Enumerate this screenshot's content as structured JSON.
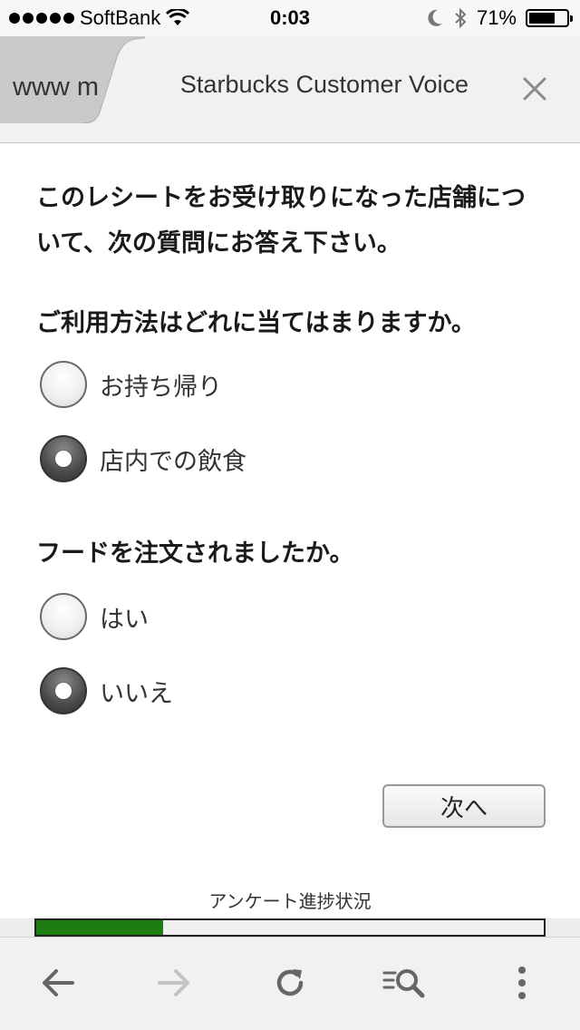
{
  "status_bar": {
    "carrier": "SoftBank",
    "time": "0:03",
    "battery": "71%",
    "battery_level": 0.71,
    "icons": [
      "signal-icon",
      "wifi-icon",
      "moon-icon",
      "bluetooth-icon",
      "battery-icon"
    ]
  },
  "tabs": {
    "inactive_label": "www m",
    "active_title": "Starbucks Customer Voice",
    "close_icon": "close-icon"
  },
  "survey": {
    "intro": "このレシートをお受け取りになった店舗について、次の質問にお答え下さい。",
    "question1": "ご利用方法はどれに当てはまりますか。",
    "q1_options": [
      {
        "label": "お持ち帰り",
        "checked": false
      },
      {
        "label": "店内での飲食",
        "checked": true
      }
    ],
    "question2": "フードを注文されましたか。",
    "q2_options": [
      {
        "label": "はい",
        "checked": false
      },
      {
        "label": "いいえ",
        "checked": true
      }
    ],
    "next_label": "次へ",
    "progress_label": "アンケート進捗状況",
    "progress": 0.25,
    "progress_color": "#1e7d11"
  },
  "toolbar": {
    "icons": [
      "back-arrow-icon",
      "forward-arrow-icon",
      "reload-icon",
      "find-in-page-icon",
      "menu-dots-icon"
    ]
  }
}
